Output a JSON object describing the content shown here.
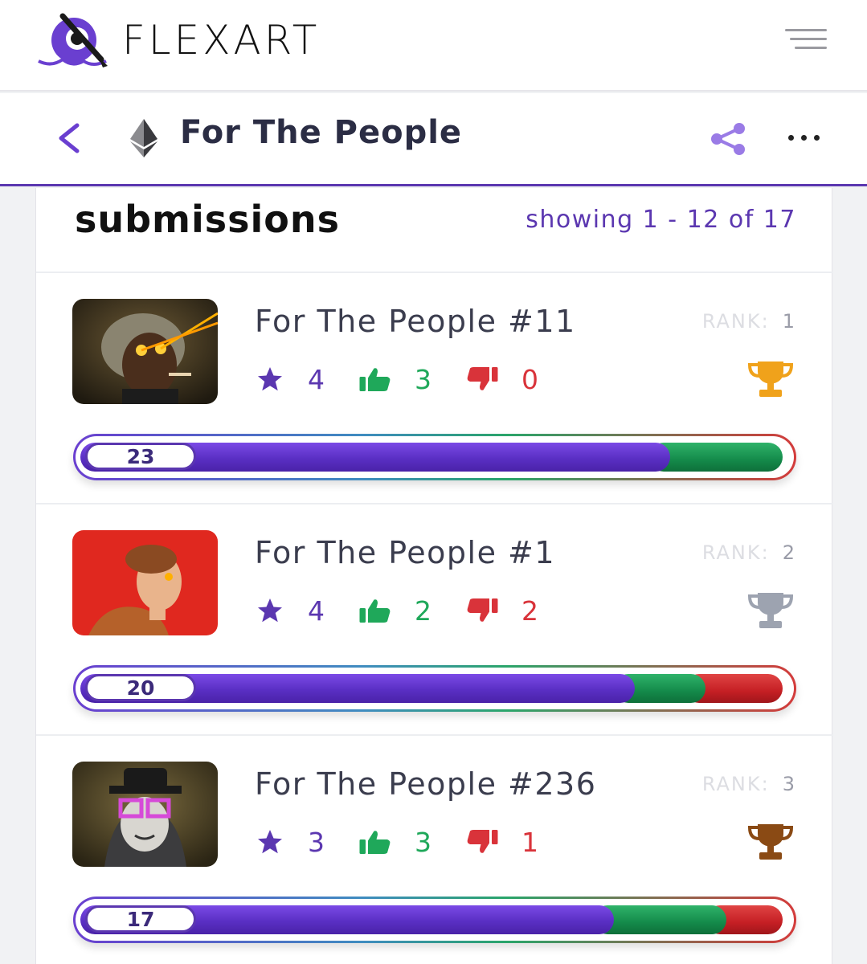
{
  "app": {
    "name": "FLEXART"
  },
  "header": {
    "title": "For The People"
  },
  "submissions": {
    "heading": "submissions",
    "showing": "showing 1 - 12 of 17",
    "items": [
      {
        "title": "For The People #11",
        "rank_label": "RANK:",
        "rank": "1",
        "stars": "4",
        "likes": "3",
        "dislikes": "0",
        "score": "23",
        "score_value": 23,
        "trophy": "gold-trophy",
        "trophy_color": "#f0a21b",
        "purple_fraction": 0.84,
        "green_fraction": 0.16,
        "red_fraction": 0.0
      },
      {
        "title": "For The People #1",
        "rank_label": "RANK:",
        "rank": "2",
        "stars": "4",
        "likes": "2",
        "dislikes": "2",
        "score": "20",
        "score_value": 20,
        "trophy": "silver-trophy",
        "trophy_color": "#9da3b0",
        "purple_fraction": 0.79,
        "green_fraction": 0.1,
        "red_fraction": 0.11
      },
      {
        "title": "For The People #236",
        "rank_label": "RANK:",
        "rank": "3",
        "stars": "3",
        "likes": "3",
        "dislikes": "1",
        "score": "17",
        "score_value": 17,
        "trophy": "bronze-trophy",
        "trophy_color": "#8a4a14",
        "purple_fraction": 0.76,
        "green_fraction": 0.16,
        "red_fraction": 0.08
      }
    ]
  },
  "colors": {
    "accent": "#5b37b0",
    "star": "#5b37b0",
    "like": "#1fa85a",
    "dislike": "#d9333a"
  }
}
